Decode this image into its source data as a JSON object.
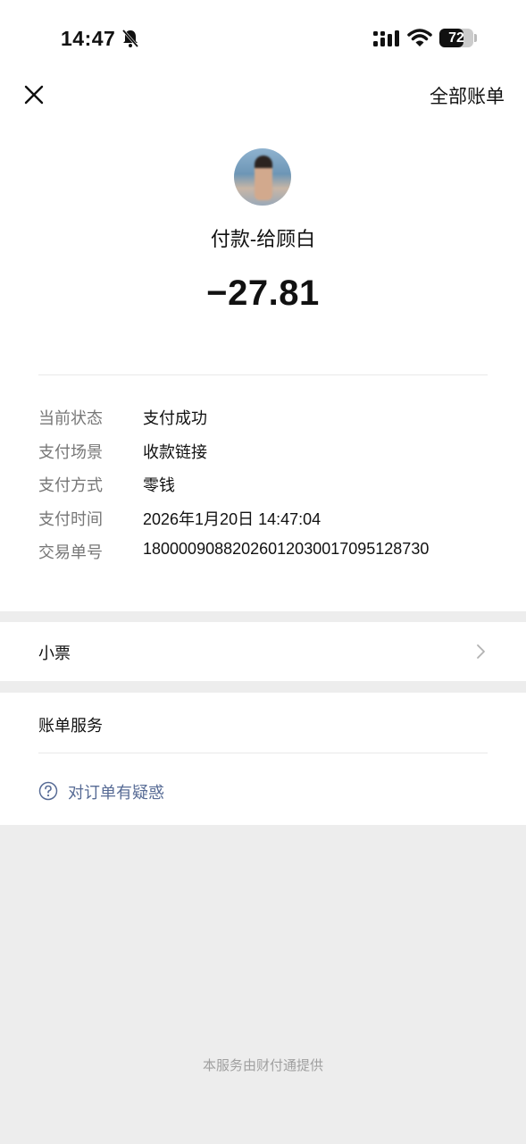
{
  "status_bar": {
    "time": "14:47",
    "battery": "72",
    "battery_level": 0.72
  },
  "header": {
    "all_bills_label": "全部账单"
  },
  "transaction": {
    "payee": "付款-给顾白",
    "amount": "−27.81"
  },
  "details": [
    {
      "label": "当前状态",
      "value": "支付成功"
    },
    {
      "label": "支付场景",
      "value": "收款链接"
    },
    {
      "label": "支付方式",
      "value": "零钱"
    },
    {
      "label": "支付时间",
      "value": "2026年1月20日 14:47:04"
    },
    {
      "label": "交易单号",
      "value": "1800009088202601203001709512873 0"
    }
  ],
  "receipt": {
    "label": "小票"
  },
  "service": {
    "title": "账单服务",
    "question_label": "对订单有疑惑"
  },
  "footer": {
    "text": "本服务由财付通提供"
  },
  "colors": {
    "link": "#576b95",
    "background": "#ededed"
  }
}
